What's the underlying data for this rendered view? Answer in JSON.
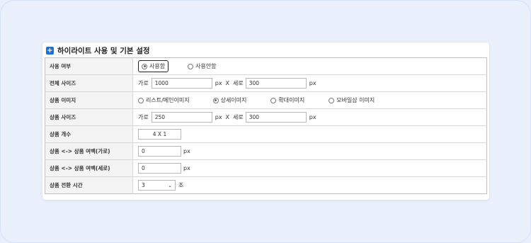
{
  "section": {
    "title": "하이라이트 사용 및 기본 설정",
    "icon": "plus-square-icon"
  },
  "rows": {
    "use": {
      "label": "사용 여부",
      "opt_use": "사용함",
      "opt_nouse": "사용안함",
      "selected": "사용함"
    },
    "total_size": {
      "label": "전체 사이즈",
      "width_label": "가로",
      "width_value": "1000",
      "unit1": "px",
      "times": "X",
      "height_label": "세로",
      "height_value": "300",
      "unit2": "px"
    },
    "image": {
      "label": "상품 이미지",
      "options": [
        "리스트/메인이미지",
        "상세이미지",
        "확대이미지",
        "모바일샵 이미지"
      ],
      "selected": "상세이미지"
    },
    "product_size": {
      "label": "상품 사이즈",
      "width_label": "가로",
      "width_value": "250",
      "unit1": "px",
      "times": "X",
      "height_label": "세로",
      "height_value": "300",
      "unit2": "px"
    },
    "count": {
      "label": "상품 개수",
      "value": "4 X 1"
    },
    "margin_h": {
      "label": "상품 <-> 상품 여백(가로)",
      "value": "0",
      "unit": "px"
    },
    "margin_v": {
      "label": "상품 <-> 상품 여백(세로)",
      "value": "0",
      "unit": "px"
    },
    "transition": {
      "label": "상품 전환 시간",
      "value": "3",
      "unit": "초"
    }
  }
}
